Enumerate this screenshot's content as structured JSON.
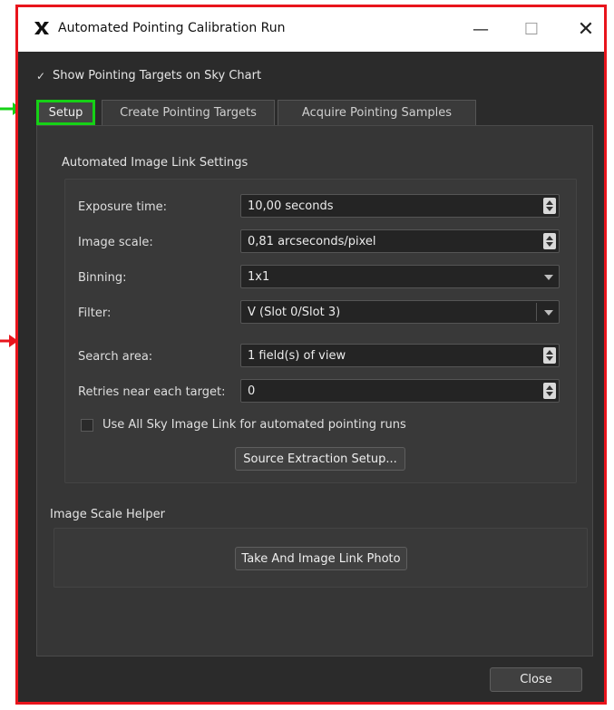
{
  "window": {
    "title": "Automated Pointing Calibration Run",
    "minimize_glyph": "—",
    "maximize_glyph": "☐",
    "close_glyph": "✕",
    "app_icon": "x-logo-icon"
  },
  "show_targets": {
    "label": "Show Pointing Targets on Sky Chart",
    "checked": true
  },
  "tabs": [
    {
      "label": "Setup",
      "active": true
    },
    {
      "label": "Create Pointing Targets",
      "active": false
    },
    {
      "label": "Acquire Pointing Samples",
      "active": false
    }
  ],
  "settings": {
    "group_title": "Automated Image Link Settings",
    "exposure": {
      "label": "Exposure time:",
      "value": "10,00 seconds"
    },
    "image_scale": {
      "label": "Image scale:",
      "value": "0,81 arcseconds/pixel"
    },
    "binning": {
      "label": "Binning:",
      "value": "1x1"
    },
    "filter": {
      "label": "Filter:",
      "value": "V (Slot 0/Slot 3)"
    },
    "search_area": {
      "label": "Search area:",
      "value": "1 field(s) of view"
    },
    "retries": {
      "label": "Retries near each target:",
      "value": "0"
    },
    "all_sky": {
      "label": "Use All Sky Image Link for automated pointing runs",
      "checked": false
    },
    "source_extraction_button": "Source Extraction Setup..."
  },
  "helper": {
    "group_title": "Image Scale Helper",
    "photo_button": "Take And Image Link Photo"
  },
  "close_button": "Close",
  "colors": {
    "window_border": "#e8141c",
    "active_tab_border": "#16d116",
    "green_arrow": "#16d116",
    "red_arrow": "#e8141c",
    "background": "#2b2b2b"
  }
}
